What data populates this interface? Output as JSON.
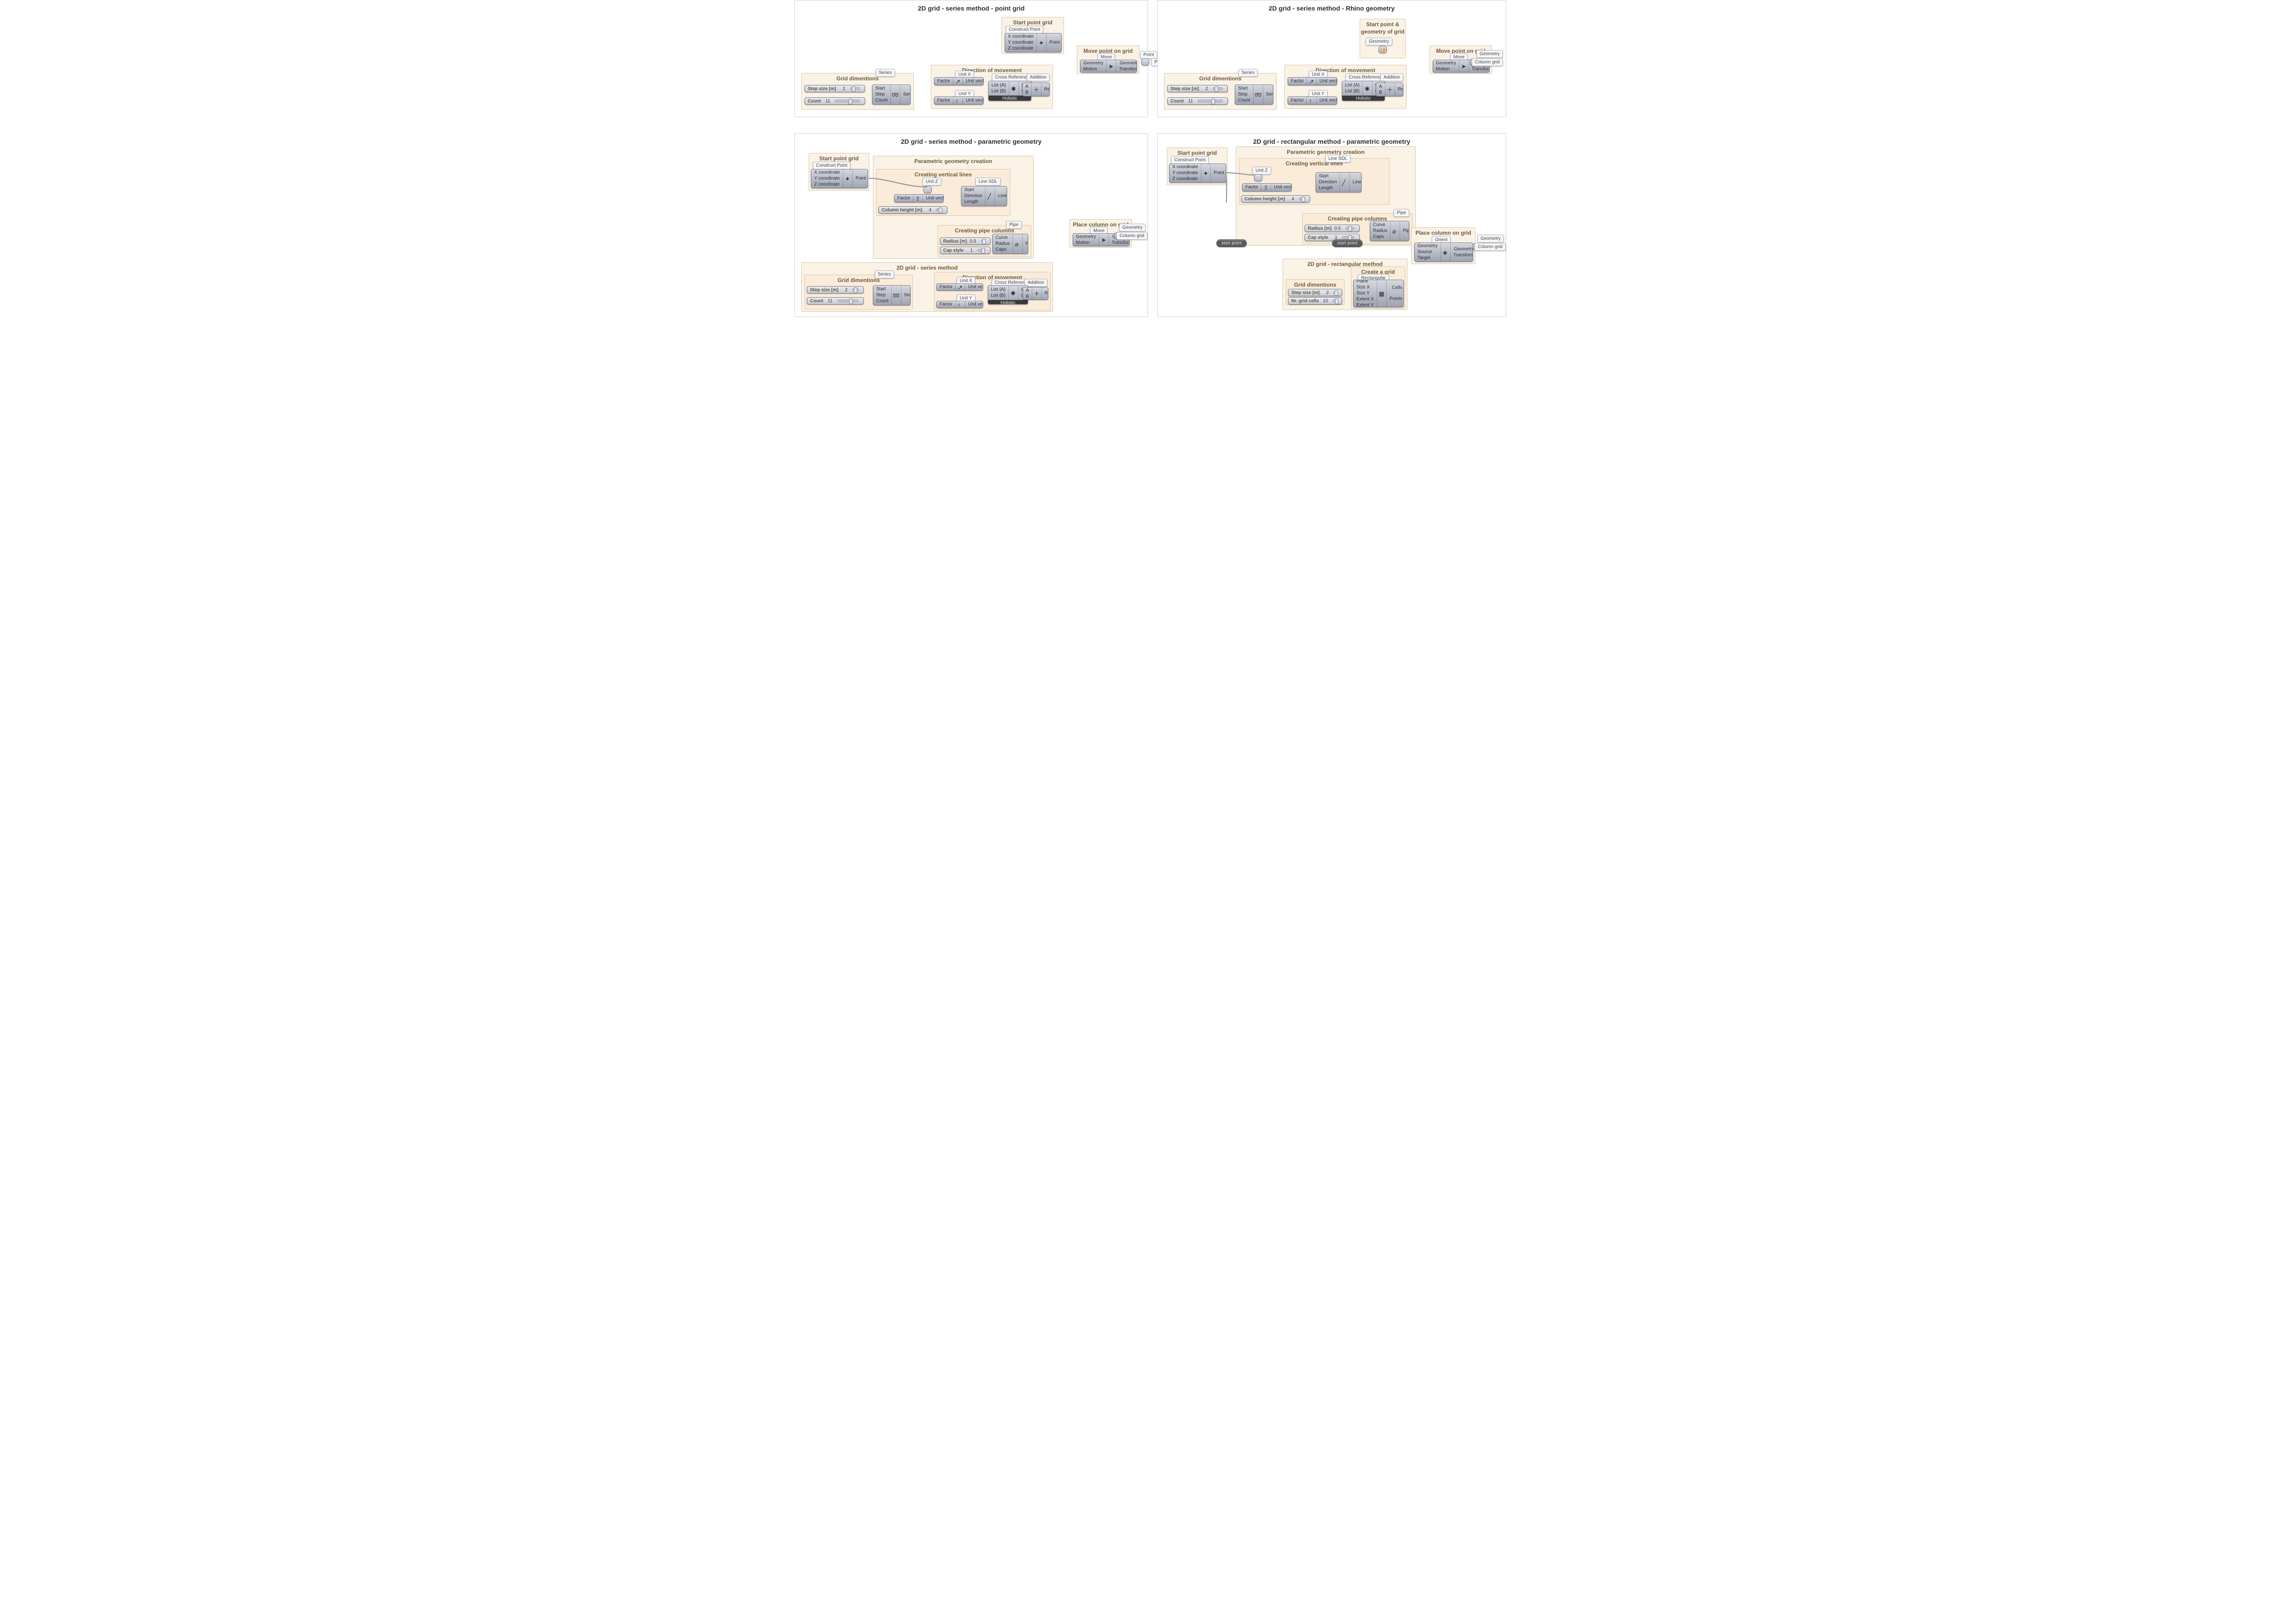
{
  "panels": {
    "pA": {
      "title": "2D grid - series method - point grid"
    },
    "pB": {
      "title": "2D grid - series method - Rhino geometry"
    },
    "pC": {
      "title": "2D grid - series method - parametric geometry"
    },
    "pD": {
      "title": "2D grid - rectangular method - parametric geometry"
    }
  },
  "groups": {
    "grid_dims": "Grid dimentions",
    "dir_move": "Direction of movement",
    "start_pt": "Start point grid",
    "start_pt_geo": "Start point &\ngeometry of grid",
    "move_pt": "Move point on grid",
    "param_geo": "Parametric geometry creation",
    "vert_lines": "Creating vertical lines",
    "pipe_cols": "Creating pipe columns",
    "place_col": "Place column on grid",
    "series2d": "2D grid - series method",
    "rect_method": "2D grid - rectangular method",
    "create_grid": "Create a grid"
  },
  "chips": {
    "series": "Series",
    "unitx": "Unit X",
    "unity": "Unit Y",
    "crossref": "Cross Reference",
    "addition": "Addition",
    "construct_pt": "Construct Point",
    "move": "Move",
    "point": "Point",
    "pts_grid": "Pts grid",
    "geometry": "Geometry",
    "col_grid": "Column grid",
    "line_sdl": "Line SDL",
    "unitz": "Unit Z",
    "pipe": "Pipe",
    "orient": "Orient",
    "rectangular": "Rectangular"
  },
  "node_labels": {
    "series_in": [
      "Start",
      "Step",
      "Count"
    ],
    "series_out": "Series",
    "unit_in": "Factor",
    "unit_out": "Unit vector",
    "cref_in": [
      "List {A}",
      "List {B}"
    ],
    "cref_out": [
      "List {A}",
      "List {B}"
    ],
    "cref_strip": "Holistic",
    "add_in": [
      "A",
      "B"
    ],
    "add_out": "Result",
    "cpt_in": [
      "X coordinate",
      "Y coordinate",
      "Z coordinate"
    ],
    "cpt_out": "Point",
    "move_in": [
      "Geometry",
      "Motion"
    ],
    "move_out": [
      "Geometry",
      "Transform"
    ],
    "line_in": [
      "Start",
      "Direction",
      "Length"
    ],
    "line_out": "Line",
    "pipe_in": [
      "Curve",
      "Radius",
      "Caps"
    ],
    "pipe_out": "Pipe",
    "orient_in": [
      "Geometry",
      "Source",
      "Target"
    ],
    "orient_out": [
      "Geometry",
      "Transform"
    ],
    "rect_in": [
      "Plane",
      "Size X",
      "Size Y",
      "Extent X",
      "Extent Y"
    ],
    "rect_out": [
      "Cells",
      "Points"
    ]
  },
  "sliders": {
    "step": {
      "label": "Step size [m]",
      "value": "2"
    },
    "count": {
      "label": "Count",
      "value": "11"
    },
    "colh": {
      "label": "Column height [m]",
      "value": "4"
    },
    "radius": {
      "label": "Radius [m]",
      "value": "0.5"
    },
    "cap": {
      "label": "Cap style",
      "value": "1"
    },
    "cells": {
      "label": "Nr. grid cells",
      "value": "10"
    }
  },
  "relays": {
    "start_point": "start point"
  }
}
